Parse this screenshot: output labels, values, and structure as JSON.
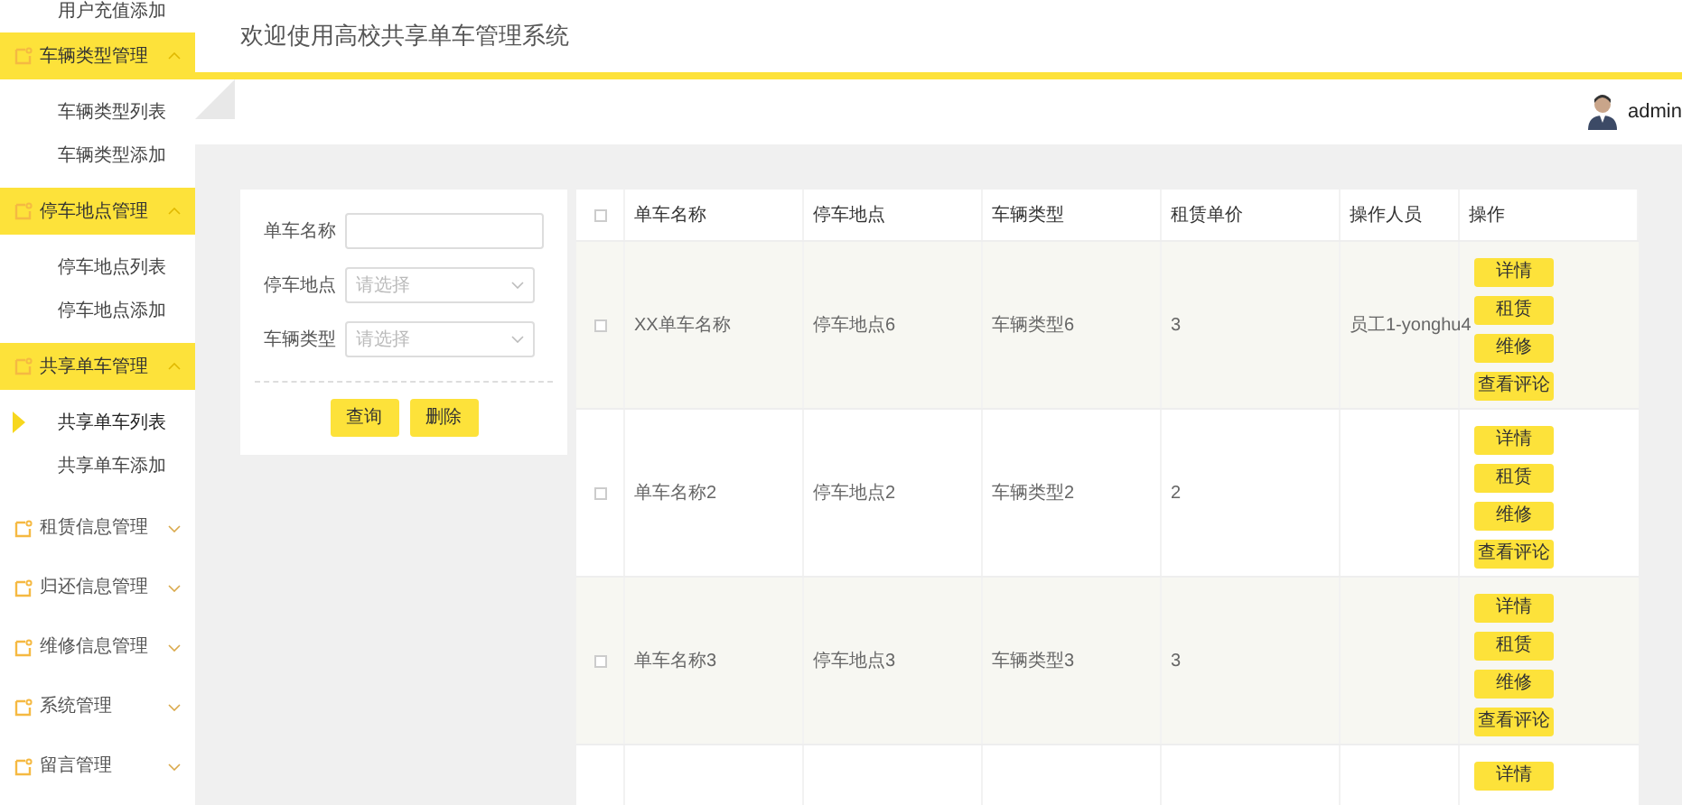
{
  "sidebar": {
    "leading_items": [
      {
        "label": "用户充值添加",
        "selected": false
      }
    ],
    "groups": [
      {
        "label": "车辆类型管理",
        "expanded": true,
        "children": [
          {
            "label": "车辆类型列表",
            "selected": false
          },
          {
            "label": "车辆类型添加",
            "selected": false
          }
        ]
      },
      {
        "label": "停车地点管理",
        "expanded": true,
        "children": [
          {
            "label": "停车地点列表",
            "selected": false
          },
          {
            "label": "停车地点添加",
            "selected": false
          }
        ]
      },
      {
        "label": "共享单车管理",
        "expanded": true,
        "children": [
          {
            "label": "共享单车列表",
            "selected": true
          },
          {
            "label": "共享单车添加",
            "selected": false
          }
        ]
      },
      {
        "label": "租赁信息管理",
        "expanded": false
      },
      {
        "label": "归还信息管理",
        "expanded": false
      },
      {
        "label": "维修信息管理",
        "expanded": false
      },
      {
        "label": "系统管理",
        "expanded": false
      },
      {
        "label": "留言管理",
        "expanded": false
      }
    ]
  },
  "header": {
    "title": "欢迎使用高校共享单车管理系统",
    "user": "admin"
  },
  "search_form": {
    "fields": [
      {
        "kind": "text",
        "label": "单车名称"
      },
      {
        "kind": "select",
        "label": "停车地点",
        "placeholder": "请选择"
      },
      {
        "kind": "select",
        "label": "车辆类型",
        "placeholder": "请选择"
      }
    ],
    "buttons": [
      "查询",
      "删除"
    ]
  },
  "table": {
    "select_all": {
      "checked": false
    },
    "columns": [
      "单车名称",
      "停车地点",
      "车辆类型",
      "租赁单价",
      "操作人员",
      "操作"
    ],
    "rows": [
      {
        "checked": false,
        "cells": [
          "XX单车名称",
          "停车地点6",
          "车辆类型6",
          "3",
          "员工1-yonghu4"
        ],
        "actions": [
          "详情",
          "租赁",
          "维修",
          "查看评论"
        ]
      },
      {
        "checked": false,
        "cells": [
          "单车名称2",
          "停车地点2",
          "车辆类型2",
          "2"
        ],
        "actions": [
          "详情",
          "租赁",
          "维修",
          "查看评论"
        ]
      },
      {
        "checked": false,
        "cells": [
          "单车名称3",
          "停车地点3",
          "车辆类型3",
          "3"
        ],
        "actions": [
          "详情",
          "租赁",
          "维修",
          "查看评论"
        ]
      },
      {
        "actions": [
          "详情"
        ]
      }
    ]
  }
}
